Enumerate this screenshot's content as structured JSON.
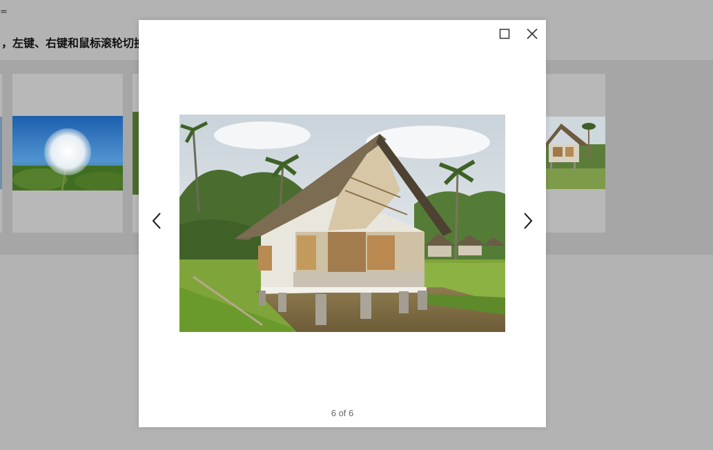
{
  "page": {
    "top_fragment": "=",
    "header_text": "，左键、右键和鼠标滚轮切换"
  },
  "gallery": {
    "thumbnails": [
      {
        "name": "cut-thumbnail",
        "subject": "partial image"
      },
      {
        "name": "dandelion",
        "subject": "dandelion seed head against blue sky"
      },
      {
        "name": "green-field",
        "subject": "green landscape"
      },
      {
        "name": "thatched-hut",
        "subject": "thatched hut on stilts"
      }
    ]
  },
  "lightbox": {
    "counter": "6 of 6",
    "image_subject": "thatched stilt house by a rice field pond",
    "icons": {
      "maximize": "maximize-icon",
      "close": "close-icon",
      "prev": "chevron-left-icon",
      "next": "chevron-right-icon"
    }
  },
  "colors": {
    "overlay_bg": "#b3b3b3",
    "modal_bg": "#ffffff",
    "counter_text": "#666666"
  }
}
